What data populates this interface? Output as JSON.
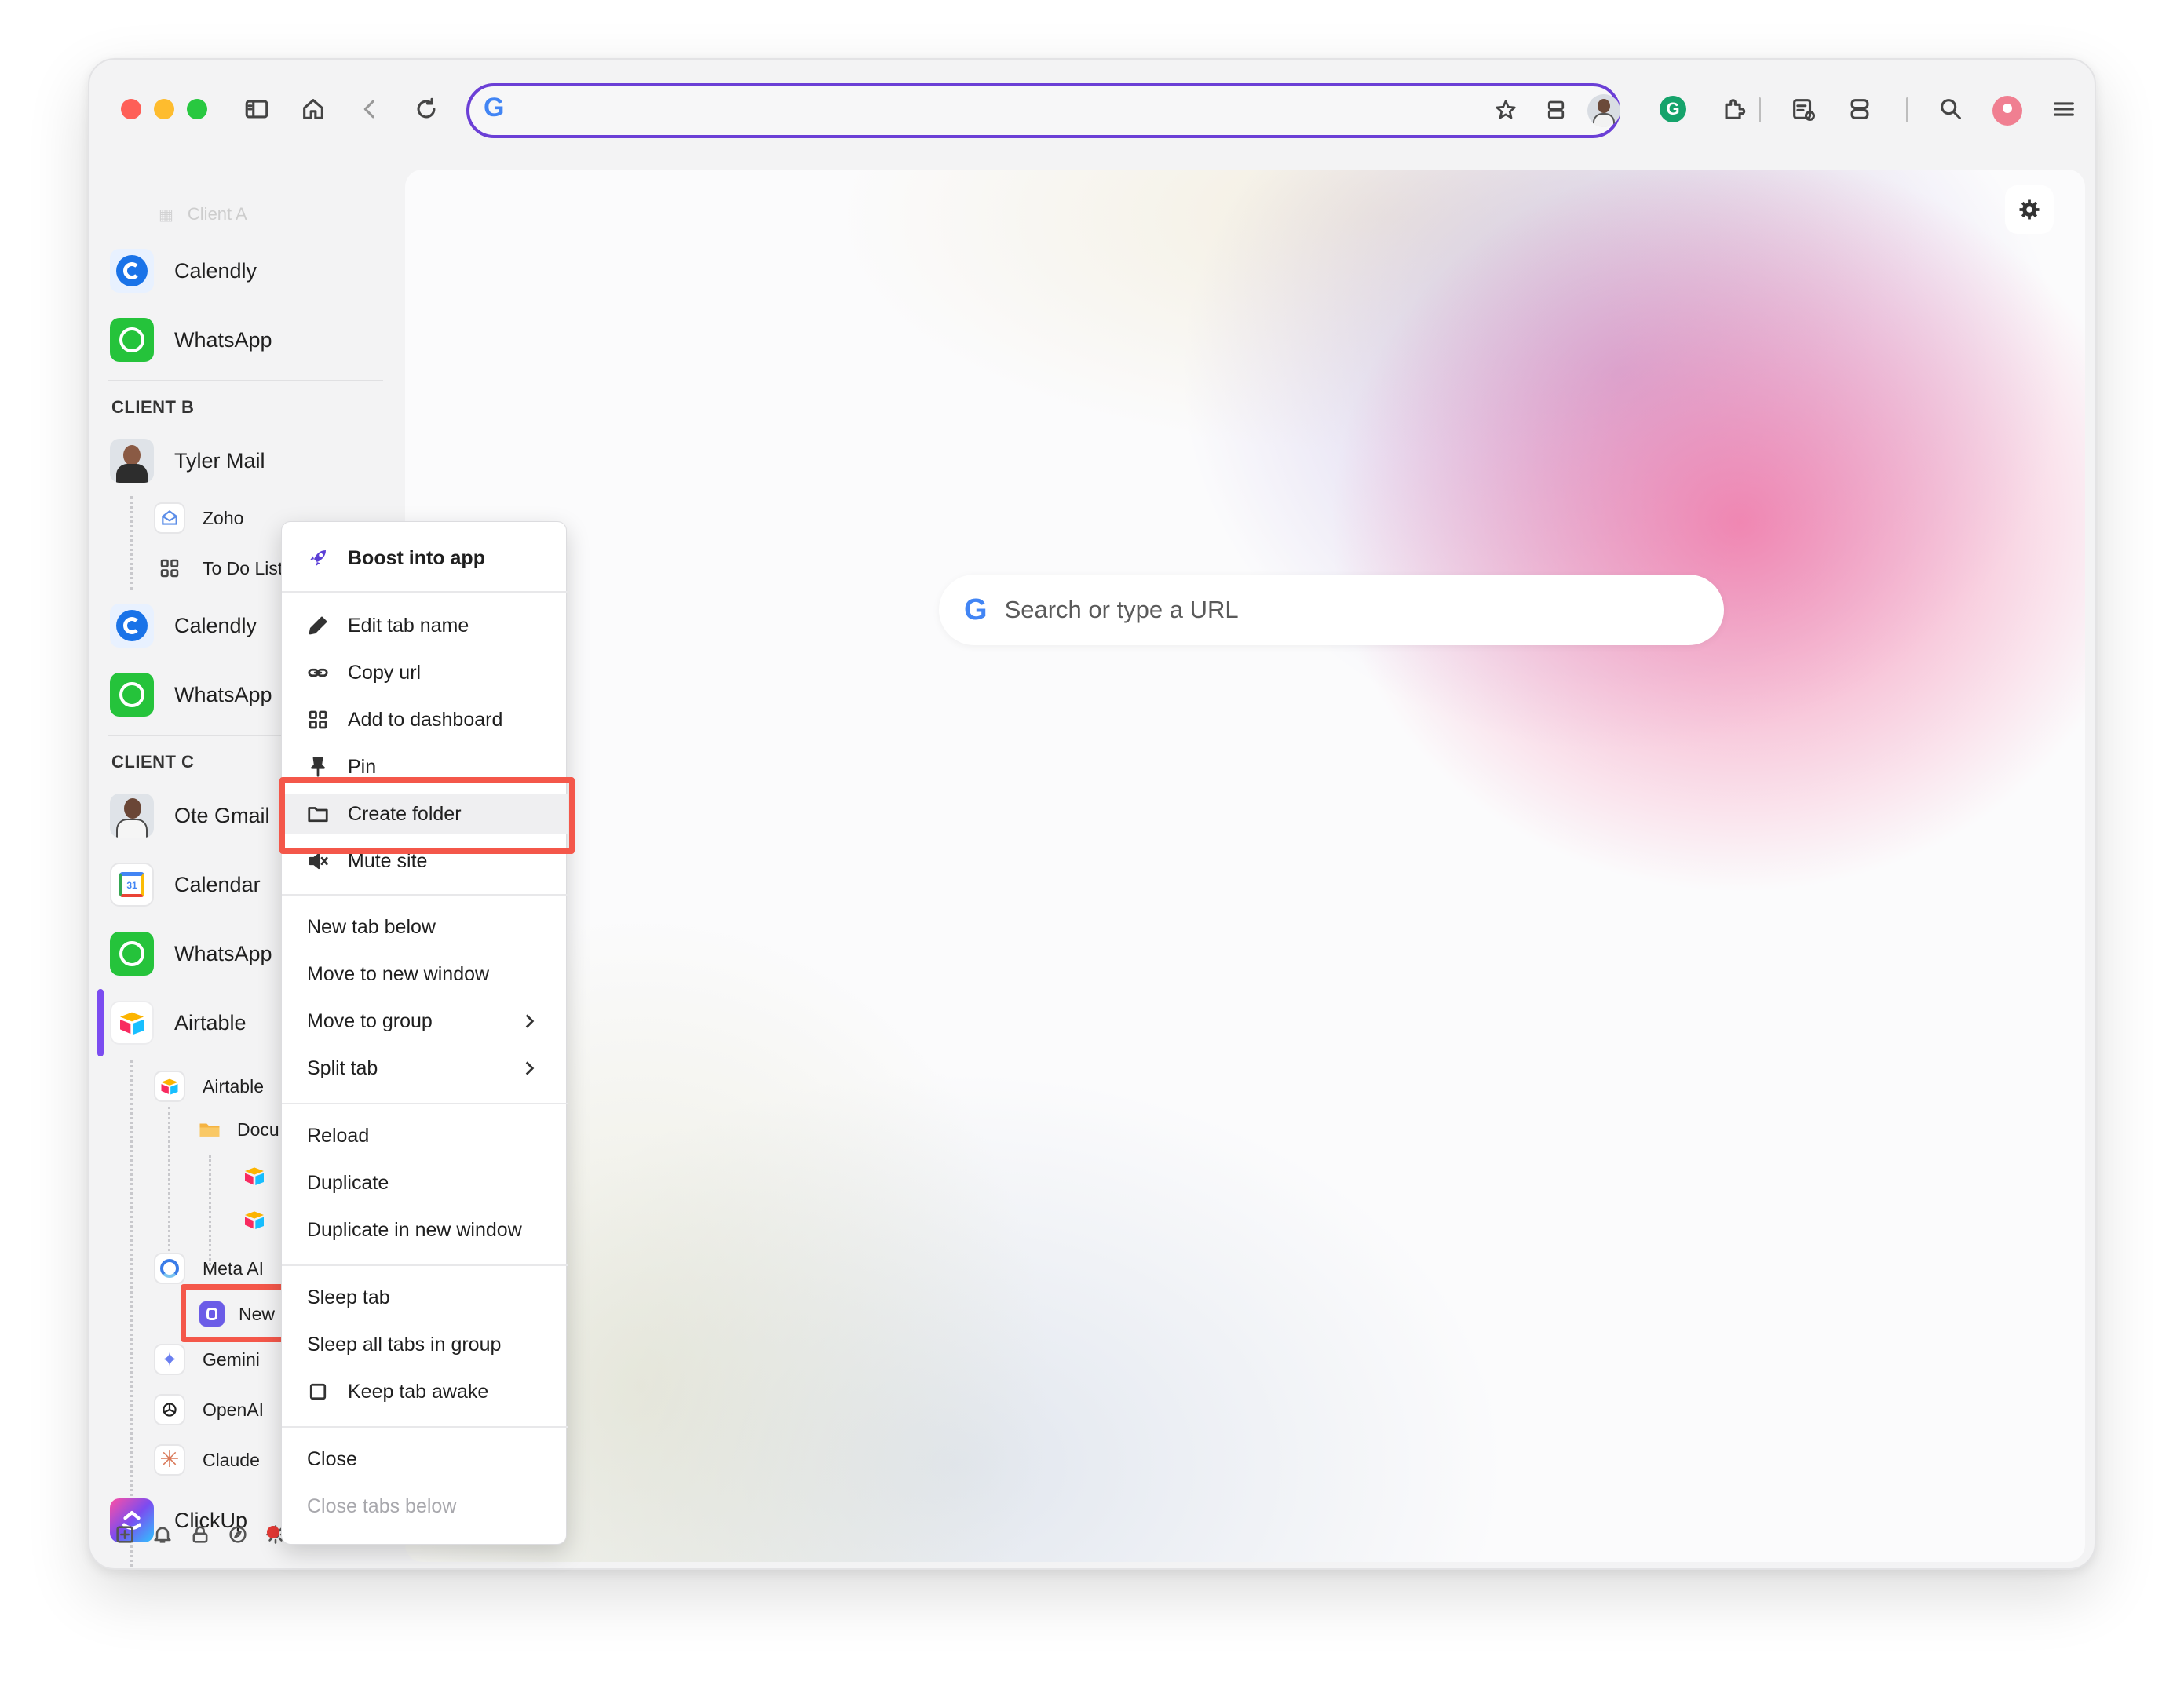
{
  "browser": {
    "url_value": "",
    "toolbar_icons": [
      "sidebar-icon",
      "home-icon",
      "back-icon",
      "reload-icon",
      "star-icon",
      "split-view-icon",
      "profile-avatar",
      "grammarly-icon",
      "extensions-icon",
      "reading-list-icon",
      "tabs-icon",
      "search-icon",
      "account-icon",
      "menu-icon"
    ]
  },
  "sidebar": {
    "faded_item": "Client A",
    "client_a_items": [
      {
        "label": "Calendly",
        "icon": "calendly-icon"
      },
      {
        "label": "WhatsApp",
        "icon": "whatsapp-icon"
      }
    ],
    "client_b": {
      "heading": "CLIENT B",
      "tyler": "Tyler Mail",
      "zoho": "Zoho",
      "todo": "To Do List",
      "calendly": "Calendly",
      "whatsapp": "WhatsApp"
    },
    "client_c": {
      "heading": "CLIENT C",
      "ote": "Ote Gmail",
      "calendar": "Calendar",
      "calendar_day": "31",
      "whatsapp": "WhatsApp",
      "airtable": "Airtable",
      "airtable_sub": "Airtable",
      "docu": "Docu",
      "meta": "Meta AI",
      "new": "New",
      "gemini": "Gemini",
      "openai": "OpenAI",
      "claude": "Claude",
      "clickup": "ClickUp"
    }
  },
  "content": {
    "search_placeholder": "Search or type a URL"
  },
  "context_menu": {
    "boost": "Boost into app",
    "edit_tab_name": "Edit tab name",
    "copy_url": "Copy url",
    "add_to_dashboard": "Add to dashboard",
    "pin": "Pin",
    "create_folder": "Create folder",
    "mute_site": "Mute site",
    "new_tab_below": "New tab below",
    "move_to_new_window": "Move to new window",
    "move_to_group": "Move to group",
    "split_tab": "Split tab",
    "reload": "Reload",
    "duplicate": "Duplicate",
    "duplicate_new_window": "Duplicate in new window",
    "sleep_tab": "Sleep tab",
    "sleep_all": "Sleep all tabs in group",
    "keep_awake": "Keep tab awake",
    "close": "Close",
    "close_below": "Close tabs below"
  },
  "colors": {
    "accent": "#6b3fd6",
    "highlight": "#f4574a",
    "active_indicator": "#7b4cf0"
  }
}
